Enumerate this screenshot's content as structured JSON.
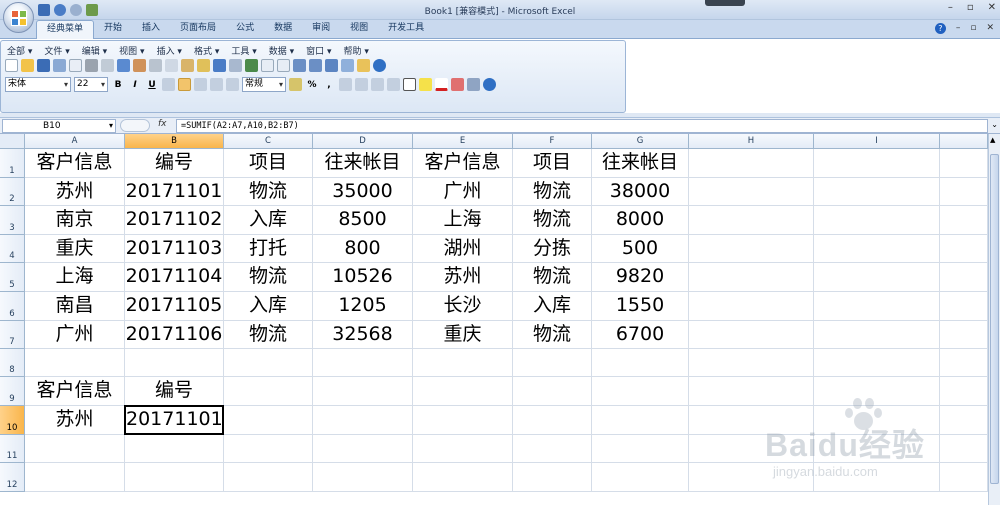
{
  "window": {
    "title": "Book1  [兼容模式] - Microsoft Excel",
    "controls": [
      "–",
      "▫",
      "✕"
    ]
  },
  "ribbon_tabs": [
    "经典菜单",
    "开始",
    "插入",
    "页面布局",
    "公式",
    "数据",
    "审阅",
    "视图",
    "开发工具"
  ],
  "active_tab": "经典菜单",
  "classic_menus": [
    "全部 ▾",
    "文件 ▾",
    "编辑 ▾",
    "视图 ▾",
    "插入 ▾",
    "格式 ▾",
    "工具 ▾",
    "数据 ▾",
    "窗口 ▾",
    "帮助 ▾"
  ],
  "format": {
    "font": "宋体",
    "size": "22",
    "bold": "B",
    "italic": "I",
    "underline": "U",
    "number_format": "常规",
    "percent": "%",
    "comma": ","
  },
  "formula_bar": {
    "name_box": "B10",
    "fx": "fx",
    "formula": "=SUMIF(A2:A7,A10,B2:B7)"
  },
  "columns": [
    "A",
    "B",
    "C",
    "D",
    "E",
    "F",
    "G",
    "H",
    "I"
  ],
  "selected_column": "B",
  "rows": [
    "1",
    "2",
    "3",
    "4",
    "5",
    "6",
    "7",
    "8",
    "9",
    "10",
    "11",
    "12"
  ],
  "selected_row": "10",
  "active_cell": "B10",
  "sheet": {
    "A1": "客户信息",
    "B1": "编号",
    "C1": "项目",
    "D1": "往来帐目",
    "E1": "客户信息",
    "F1": "项目",
    "G1": "往来帐目",
    "A2": "苏州",
    "B2": "20171101",
    "C2": "物流",
    "D2": "35000",
    "E2": "广州",
    "F2": "物流",
    "G2": "38000",
    "A3": "南京",
    "B3": "20171102",
    "C3": "入库",
    "D3": "8500",
    "E3": "上海",
    "F3": "物流",
    "G3": "8000",
    "A4": "重庆",
    "B4": "20171103",
    "C4": "打托",
    "D4": "800",
    "E4": "湖州",
    "F4": "分拣",
    "G4": "500",
    "A5": "上海",
    "B5": "20171104",
    "C5": "物流",
    "D5": "10526",
    "E5": "苏州",
    "F5": "物流",
    "G5": "9820",
    "A6": "南昌",
    "B6": "20171105",
    "C6": "入库",
    "D6": "1205",
    "E6": "长沙",
    "F6": "入库",
    "G6": "1550",
    "A7": "广州",
    "B7": "20171106",
    "C7": "物流",
    "D7": "32568",
    "E7": "重庆",
    "F7": "物流",
    "G7": "6700",
    "A9": "客户信息",
    "B9": "编号",
    "A10": "苏州",
    "B10": "20171101"
  },
  "watermark": {
    "brand": "Baidu经验",
    "url": "jingyan.baidu.com"
  }
}
